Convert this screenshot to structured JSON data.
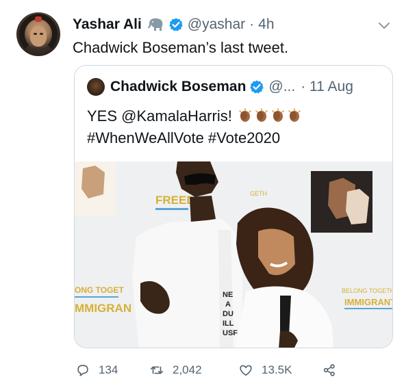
{
  "tweet": {
    "author_name": "Yashar Ali",
    "handle": "@yashar",
    "separator": "·",
    "time": "4h",
    "text": "Chadwick Boseman’s last tweet.",
    "icons": [
      "elephant-icon",
      "verified-icon",
      "chevron-down-icon"
    ]
  },
  "quoted": {
    "author_name": "Chadwick Boseman",
    "handle": "@...",
    "time": "· 11 Aug",
    "line1": "YES @KamalaHarris!",
    "line2": "#WhenWeAllVote #Vote2020",
    "photo_signs": {
      "freedom": "FREED",
      "belong_left": "ONG TOGET",
      "immigrants_left": "MMIGRAN",
      "belong_right": "BELONG TOGETHER",
      "immigrants_right": "IMMIGRANTS!",
      "together": "GETH",
      "shirt": "NE\nA\nDU\nILL\nUSF"
    }
  },
  "actions": {
    "reply_count": "134",
    "retweet_count": "2,042",
    "like_count": "13.5K"
  },
  "colors": {
    "text": "#0f1419",
    "secondary": "#536471",
    "verified": "#1d9bf0",
    "border": "#cfd9de",
    "sign_yellow": "#d7b035",
    "sign_blue": "#5aa4d6"
  }
}
